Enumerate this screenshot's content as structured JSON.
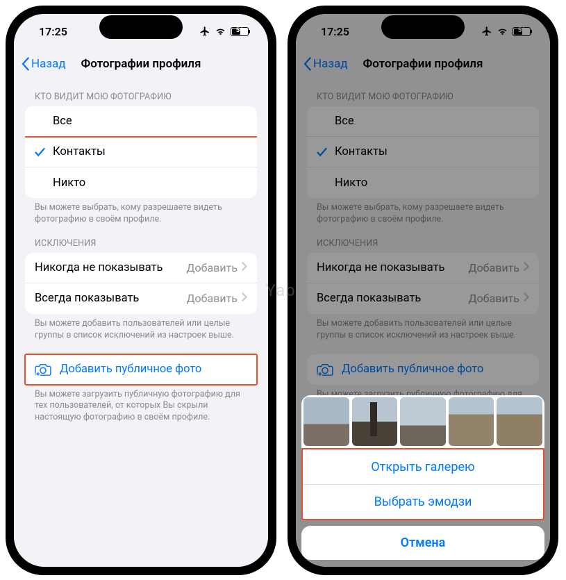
{
  "status": {
    "time": "17:25",
    "battery": "56"
  },
  "nav": {
    "back": "Назад",
    "title": "Фотографии профиля"
  },
  "visibility": {
    "header": "КТО ВИДИТ МОЮ ФОТОГРАФИЮ",
    "options": [
      "Все",
      "Контакты",
      "Никто"
    ],
    "selected_index": 1,
    "footer": "Вы можете выбрать, кому разрешаете видеть фотографию в своём профиле."
  },
  "exceptions": {
    "header": "ИСКЛЮЧЕНИЯ",
    "rows": [
      {
        "label": "Никогда не показывать",
        "value": "Добавить"
      },
      {
        "label": "Всегда показывать",
        "value": "Добавить"
      }
    ],
    "footer": "Вы можете добавить пользователей или целые группы в список исключений из настроек выше."
  },
  "public_photo": {
    "label": "Добавить публичное фото",
    "footer_full": "Вы можете загрузить публичную фотографию для тех пользователей, от которых Вы скрыли настоящую фотографию в своём профиле.",
    "footer_cut": "Вы можете загрузить публичную фотографию для тех пользователей, от которых Вы скрыли настоящую"
  },
  "sheet": {
    "open_gallery": "Открыть галерею",
    "choose_emoji": "Выбрать эмодзи",
    "cancel": "Отмена"
  },
  "watermark": "Yabl"
}
